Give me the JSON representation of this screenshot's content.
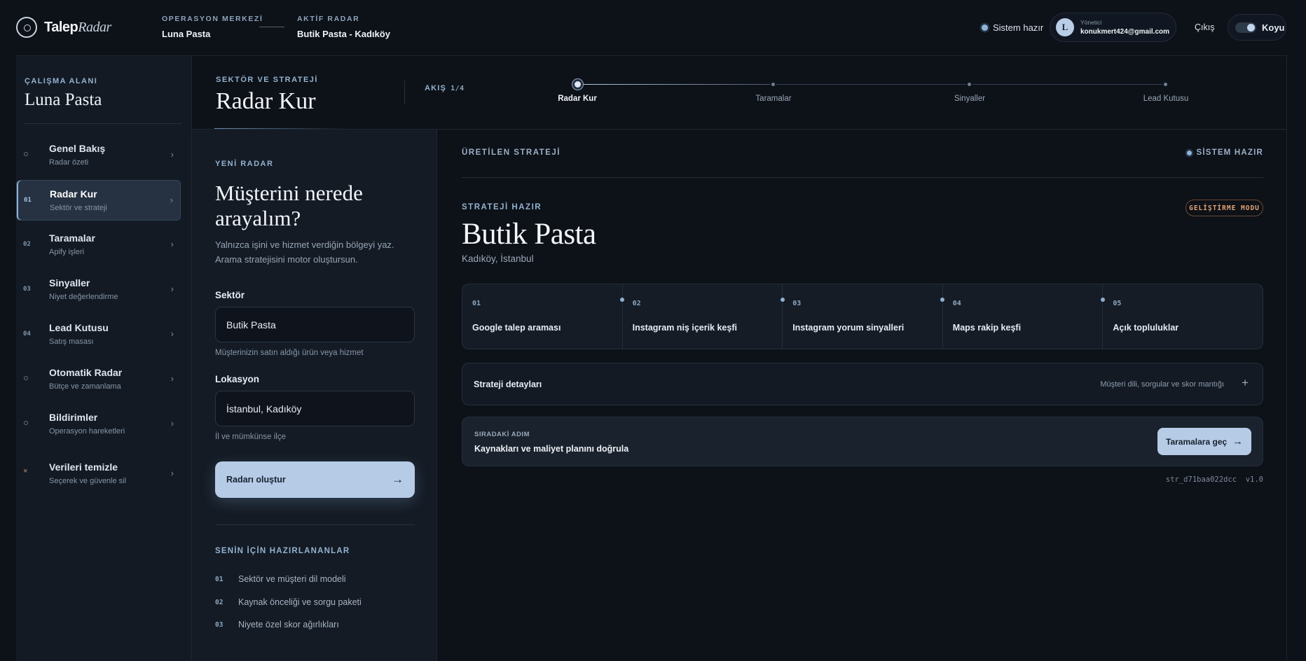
{
  "brand": {
    "name": "Talep",
    "name_accent": "Radar"
  },
  "header": {
    "ops_center_label": "OPERASYON MERKEZİ",
    "ops_center_value": "Luna Pasta",
    "active_radar_label": "AKTİF RADAR",
    "active_radar_value": "Butik Pasta - Kadıköy",
    "system_status": "Sistem hazır",
    "user_role": "Yönetici",
    "user_email": "konukmert424@gmail.com",
    "avatar_initial": "L",
    "logout": "Çıkış",
    "theme_label": "Koyu"
  },
  "sidebar": {
    "workspace_label": "ÇALIŞMA ALANI",
    "workspace_name": "Luna Pasta",
    "items": [
      {
        "marker": "○",
        "label": "Genel Bakış",
        "sub": "Radar özeti"
      },
      {
        "marker": "01",
        "label": "Radar Kur",
        "sub": "Sektör ve strateji",
        "active": true
      },
      {
        "marker": "02",
        "label": "Taramalar",
        "sub": "Apify işleri"
      },
      {
        "marker": "03",
        "label": "Sinyaller",
        "sub": "Niyet değerlendirme"
      },
      {
        "marker": "04",
        "label": "Lead Kutusu",
        "sub": "Satış masası"
      },
      {
        "marker": "○",
        "label": "Otomatik Radar",
        "sub": "Bütçe ve zamanlama"
      },
      {
        "marker": "○",
        "label": "Bildirimler",
        "sub": "Operasyon hareketleri"
      },
      {
        "marker": "×",
        "label": "Verileri temizle",
        "sub": "Seçerek ve güvenle sil"
      }
    ]
  },
  "page_header": {
    "kicker": "SEKTÖR VE STRATEJİ",
    "title": "Radar Kur",
    "flow_label": "AKIŞ",
    "flow_progress": "1/4",
    "steps": [
      "Radar Kur",
      "Taramalar",
      "Sinyaller",
      "Lead Kutusu"
    ]
  },
  "form": {
    "kicker": "YENİ RADAR",
    "title": "Müşterini nerede arayalım?",
    "description": "Yalnızca işini ve hizmet verdiğin bölgeyi yaz. Arama stratejisini motor oluştursun.",
    "sector_label": "Sektör",
    "sector_value": "Butik Pasta",
    "sector_hint": "Müşterinizin satın aldığı ürün veya hizmet",
    "location_label": "Lokasyon",
    "location_value": "İstanbul, Kadıköy",
    "location_hint": "İl ve mümkünse ilçe",
    "submit_label": "Radarı oluştur",
    "submit_arrow": "→",
    "prepared_title": "SENİN İÇİN HAZIRLANANLAR",
    "prepared_items": [
      {
        "num": "01",
        "text": "Sektör ve müşteri dil modeli"
      },
      {
        "num": "02",
        "text": "Kaynak önceliği ve sorgu paketi"
      },
      {
        "num": "03",
        "text": "Niyete özel skor ağırlıkları"
      }
    ]
  },
  "strategy": {
    "section_label": "ÜRETİLEN STRATEJİ",
    "system_ready": "SİSTEM HAZIR",
    "ready_kicker": "STRATEJİ HAZIR",
    "dev_badge": "GELİŞTİRME MODU",
    "title": "Butik Pasta",
    "location": "Kadıköy, İstanbul",
    "sources": [
      {
        "num": "01",
        "name": "Google talep araması"
      },
      {
        "num": "02",
        "name": "Instagram niş içerik keşfi"
      },
      {
        "num": "03",
        "name": "Instagram yorum sinyalleri"
      },
      {
        "num": "04",
        "name": "Maps rakip keşfi"
      },
      {
        "num": "05",
        "name": "Açık topluluklar"
      }
    ],
    "details_title": "Strateji detayları",
    "details_sub": "Müşteri dili, sorgular ve skor mantığı",
    "details_toggle": "+",
    "next_kicker": "SIRADAKİ ADIM",
    "next_text": "Kaynakları ve maliyet planını doğrula",
    "next_button": "Taramalara geç",
    "next_arrow": "→",
    "strategy_id": "str_d71baa022dcc",
    "version": "v1.0"
  },
  "colors": {
    "accent": "#b6cbe6",
    "background": "#0d1118",
    "panel": "#141b25",
    "dev_badge": "#e0a274"
  }
}
